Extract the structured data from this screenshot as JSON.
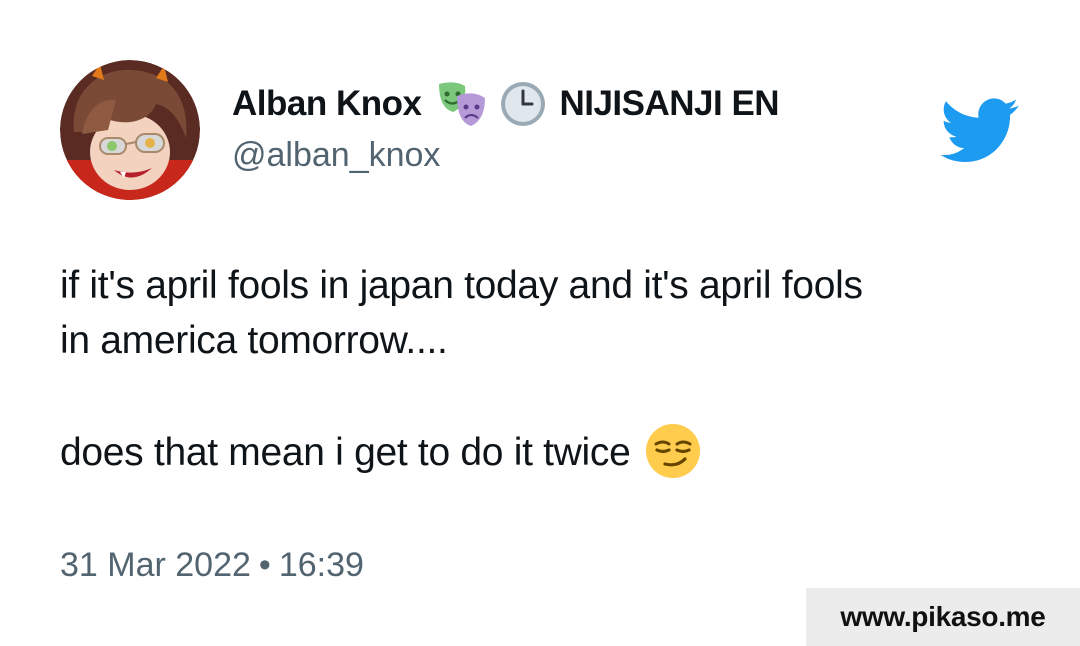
{
  "user": {
    "display_name": "Alban Knox",
    "name_suffix": "NIJISANJI EN",
    "handle": "@alban_knox",
    "name_icons": [
      "performing-arts-emoji",
      "clock-emoji"
    ]
  },
  "tweet": {
    "lines": [
      "if it's april fools in japan today and it's april fools",
      "in america tomorrow....",
      "",
      "does that mean i get to do it twice"
    ],
    "trailing_icon": "smirking-face-emoji"
  },
  "meta": {
    "date": "31 Mar 2022",
    "separator": "•",
    "time": "16:39"
  },
  "branding": {
    "network_icon": "twitter-bird-icon",
    "network_color": "#1d9bf0",
    "watermark": "www.pikaso.me"
  },
  "colors": {
    "text": "#0f1419",
    "secondary_text": "#536471",
    "watermark_bg": "#ececec"
  }
}
